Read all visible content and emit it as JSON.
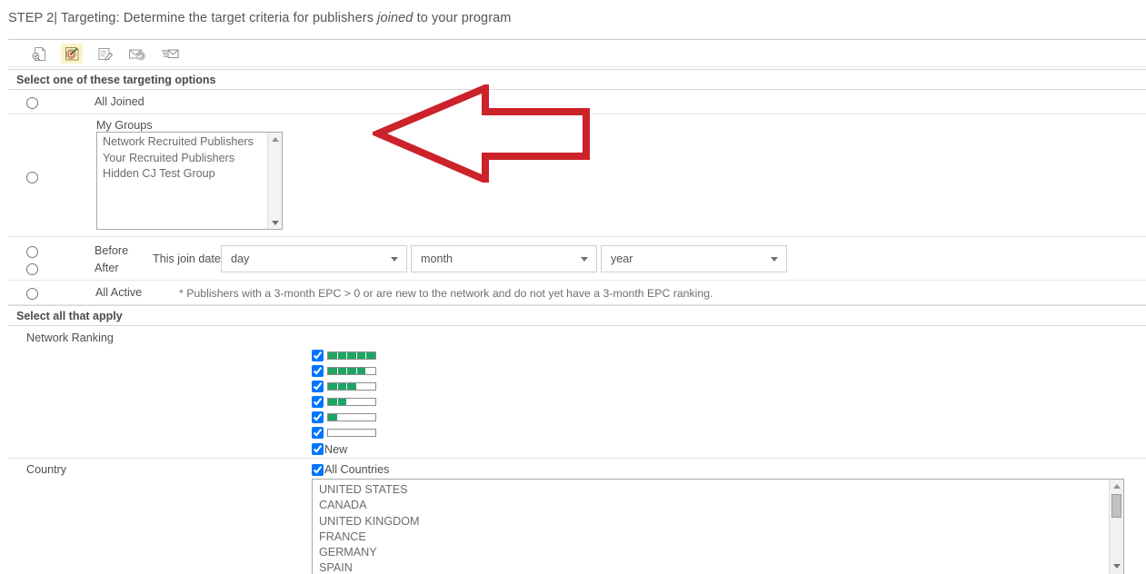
{
  "step": {
    "prefix": "STEP 2| ",
    "text_before": "Targeting: Determine the target criteria for publishers ",
    "emphasis": "joined",
    "text_after": " to your program"
  },
  "toolbar": {
    "items": [
      {
        "name": "offers-document-icon",
        "title": "Offers",
        "active": false
      },
      {
        "name": "target-bullseye-icon",
        "title": "Targeting",
        "active": true
      },
      {
        "name": "compose-message-icon",
        "title": "Compose",
        "active": false
      },
      {
        "name": "send-mail-refresh-icon",
        "title": "Send",
        "active": false
      },
      {
        "name": "mail-list-icon",
        "title": "Review",
        "active": false
      }
    ]
  },
  "sections": {
    "targeting_header": "Select one of these targeting options",
    "apply_header": "Select all that apply"
  },
  "targeting": {
    "all_joined_label": "All Joined",
    "my_groups_label": "My Groups",
    "my_groups_options": [
      "Network Recruited Publishers",
      "Your Recruited Publishers",
      "Hidden CJ Test Group"
    ],
    "before_label": "Before",
    "after_label": "After",
    "join_date_label": "This join date",
    "day_select": "day",
    "month_select": "month",
    "year_select": "year",
    "all_active_label": "All Active",
    "all_active_note": "* Publishers with a 3-month EPC > 0 or are new to the network and do not yet have a 3-month EPC ranking."
  },
  "network_ranking": {
    "label": "Network Ranking",
    "bar_segments": 5,
    "fill_color": "#1fa463",
    "rows": [
      {
        "checked": true,
        "filled": 5
      },
      {
        "checked": true,
        "filled": 4
      },
      {
        "checked": true,
        "filled": 3
      },
      {
        "checked": true,
        "filled": 2
      },
      {
        "checked": true,
        "filled": 1
      },
      {
        "checked": true,
        "filled": 0
      }
    ],
    "new_label": "New",
    "new_checked": true
  },
  "country": {
    "label": "Country",
    "all_countries_label": "All Countries",
    "all_countries_checked": true,
    "options": [
      "UNITED STATES",
      "CANADA",
      "UNITED KINGDOM",
      "FRANCE",
      "GERMANY",
      "SPAIN"
    ]
  },
  "annotation": {
    "arrow_color": "#cc2229",
    "arrow_direction": "left"
  }
}
